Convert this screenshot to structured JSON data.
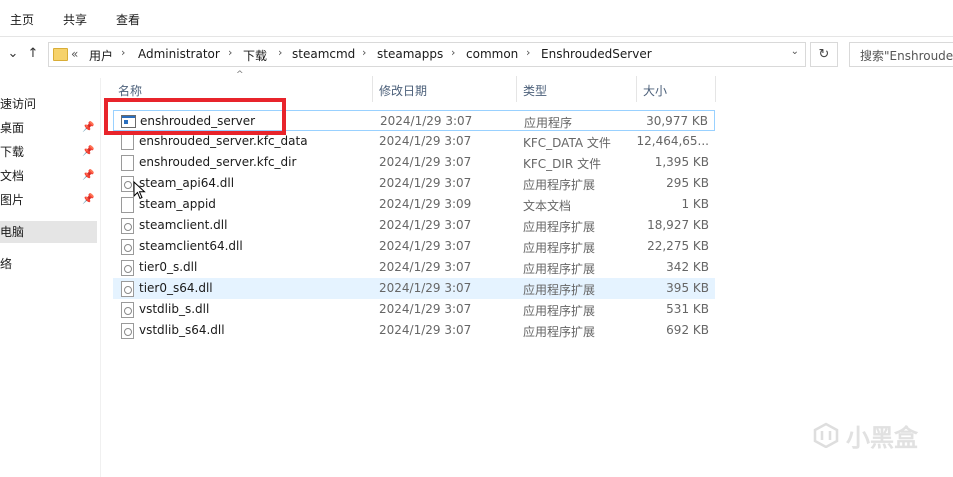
{
  "ribbon": {
    "tabs": [
      "主页",
      "共享",
      "查看"
    ]
  },
  "address": {
    "overflow": "«",
    "crumbs": [
      "用户",
      "Administrator",
      "下载",
      "steamcmd",
      "steamapps",
      "common",
      "EnshroudedServer"
    ],
    "search_placeholder": "搜索\"Enshrouded"
  },
  "sidebar": {
    "items": [
      {
        "label": "速访问",
        "pinned": false
      },
      {
        "label": "桌面",
        "pinned": true
      },
      {
        "label": "下载",
        "pinned": true
      },
      {
        "label": "文档",
        "pinned": true
      },
      {
        "label": "图片",
        "pinned": true
      },
      {
        "label": "电脑",
        "pinned": false,
        "selected": true
      },
      {
        "label": "络",
        "pinned": false
      }
    ]
  },
  "columns": {
    "name": "名称",
    "date": "修改日期",
    "type": "类型",
    "size": "大小"
  },
  "files": [
    {
      "name": "enshrouded_server",
      "date": "2024/1/29 3:07",
      "type": "应用程序",
      "size": "30,977 KB",
      "icon": "exe-icon"
    },
    {
      "name": "enshrouded_server.kfc_data",
      "date": "2024/1/29 3:07",
      "type": "KFC_DATA 文件",
      "size": "12,464,65...",
      "icon": "file-icon"
    },
    {
      "name": "enshrouded_server.kfc_dir",
      "date": "2024/1/29 3:07",
      "type": "KFC_DIR 文件",
      "size": "1,395 KB",
      "icon": "file-icon"
    },
    {
      "name": "steam_api64.dll",
      "date": "2024/1/29 3:07",
      "type": "应用程序扩展",
      "size": "295 KB",
      "icon": "dll-icon"
    },
    {
      "name": "steam_appid",
      "date": "2024/1/29 3:09",
      "type": "文本文档",
      "size": "1 KB",
      "icon": "text-file-icon"
    },
    {
      "name": "steamclient.dll",
      "date": "2024/1/29 3:07",
      "type": "应用程序扩展",
      "size": "18,927 KB",
      "icon": "dll-icon"
    },
    {
      "name": "steamclient64.dll",
      "date": "2024/1/29 3:07",
      "type": "应用程序扩展",
      "size": "22,275 KB",
      "icon": "dll-icon"
    },
    {
      "name": "tier0_s.dll",
      "date": "2024/1/29 3:07",
      "type": "应用程序扩展",
      "size": "342 KB",
      "icon": "dll-icon"
    },
    {
      "name": "tier0_s64.dll",
      "date": "2024/1/29 3:07",
      "type": "应用程序扩展",
      "size": "395 KB",
      "icon": "dll-icon"
    },
    {
      "name": "vstdlib_s.dll",
      "date": "2024/1/29 3:07",
      "type": "应用程序扩展",
      "size": "531 KB",
      "icon": "dll-icon"
    },
    {
      "name": "vstdlib_s64.dll",
      "date": "2024/1/29 3:07",
      "type": "应用程序扩展",
      "size": "692 KB",
      "icon": "dll-icon"
    }
  ],
  "watermark": "小黑盒",
  "colors": {
    "highlight_box": "#e8242b",
    "hover_row": "#e5f3ff",
    "header_text": "#4c607a"
  }
}
